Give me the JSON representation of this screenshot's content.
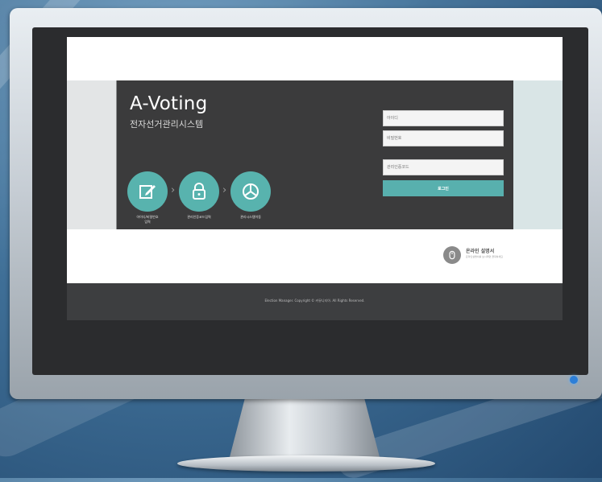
{
  "app": {
    "title": "A-Voting",
    "subtitle": "전자선거관리시스템"
  },
  "login": {
    "id_placeholder": "아이디",
    "password_placeholder": "비밀번호",
    "auth_code_placeholder": "관리인증코드",
    "submit_label": "로그인"
  },
  "steps": [
    {
      "label": "아이디/비밀번호\n입력",
      "icon": "edit-icon"
    },
    {
      "label": "관리인증코드입력",
      "icon": "lock-icon"
    },
    {
      "label": "관리시스템이동",
      "icon": "pie-chart-icon"
    }
  ],
  "manual": {
    "title": "온라인 설명서",
    "description": "온라인설명서를 보시려면 클릭하세요",
    "icon": "mouse-icon"
  },
  "footer": {
    "copyright": "Election Manager. Copyright © 커뮤니티아. All Rights Reserved."
  },
  "colors": {
    "accent": "#58b3ae",
    "panel": "#3b3b3c",
    "footer": "#3d3e40",
    "power_led": "#2d7fd8"
  }
}
